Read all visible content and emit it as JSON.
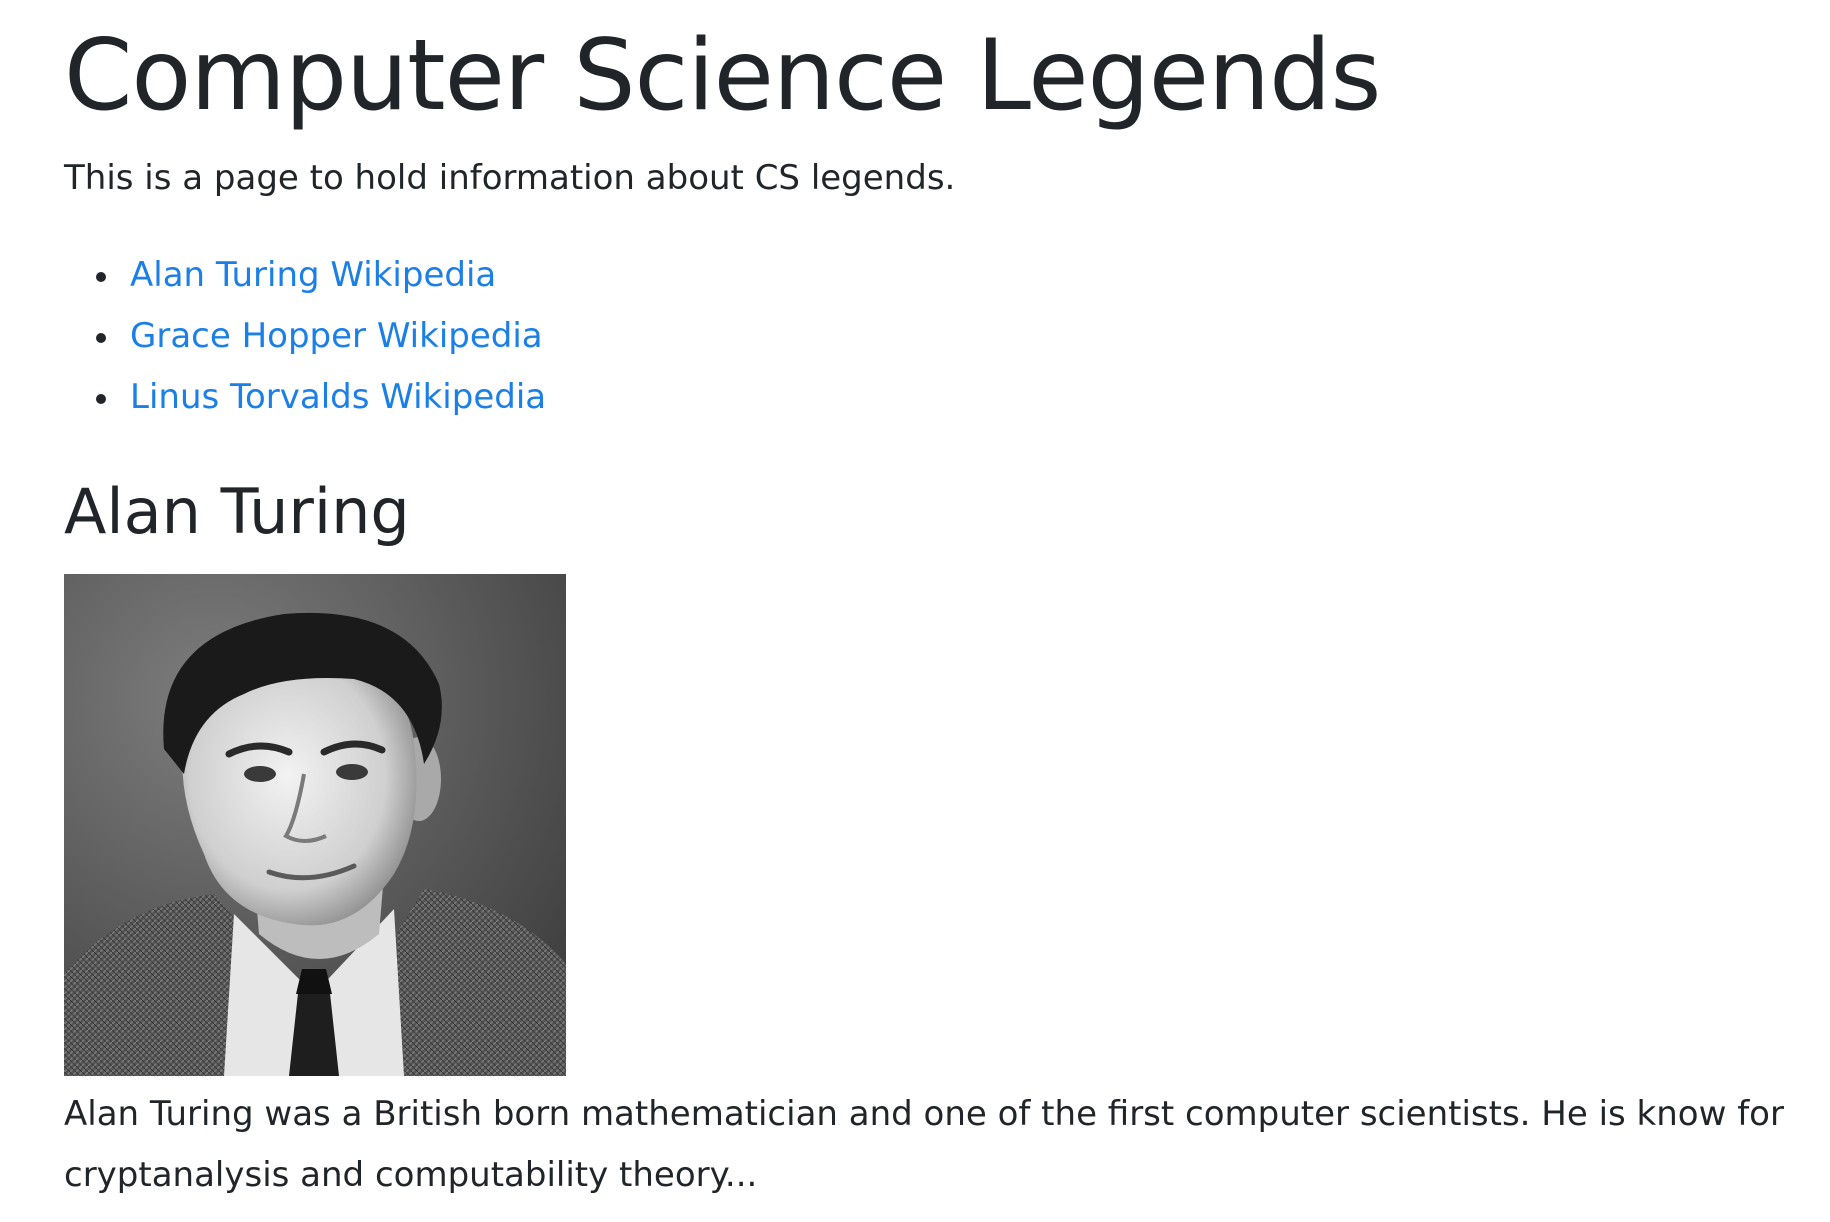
{
  "header": {
    "title": "Computer Science Legends",
    "intro": "This is a page to hold information about CS legends."
  },
  "links": [
    {
      "label": "Alan Turing Wikipedia"
    },
    {
      "label": "Grace Hopper Wikipedia"
    },
    {
      "label": "Linus Torvalds Wikipedia"
    }
  ],
  "section": {
    "title": "Alan Turing",
    "image_alt": "Alan Turing",
    "bio": "Alan Turing was a British born mathematician and one of the first computer scientists. He is know for cryptanalysis and computability theory..."
  },
  "colors": {
    "text": "#212529",
    "link": "#1a7fe6",
    "background": "#ffffff"
  }
}
